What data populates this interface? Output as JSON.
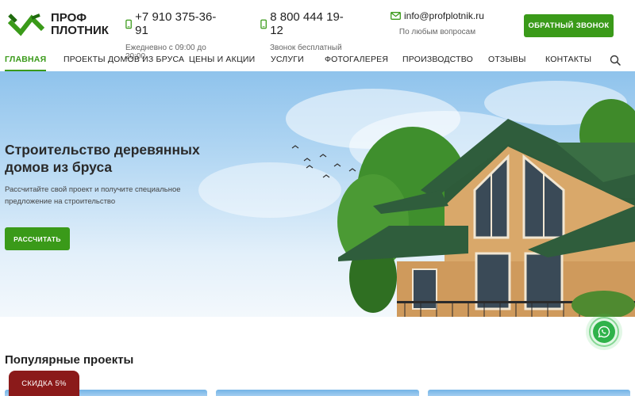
{
  "brand": {
    "name_line1": "ПРОФ",
    "name_line2": "ПЛОТНИК",
    "colors": {
      "accent": "#3a9a19",
      "discount": "#8b1a1a",
      "whatsapp": "#2fb24a"
    }
  },
  "header": {
    "phone1": {
      "number": "+7 910 375-36-91",
      "note": "Ежедневно с 09:00 до 20:00",
      "icon": "phone-icon"
    },
    "phone2": {
      "number": "8 800 444 19-12",
      "note": "Звонок бесплатный",
      "icon": "phone-icon"
    },
    "email": {
      "address": "info@profplotnik.ru",
      "note": "По любым вопросам",
      "icon": "mail-icon"
    },
    "callback_label": "ОБРАТНЫЙ ЗВОНОК"
  },
  "nav": {
    "items": [
      {
        "label": "ГЛАВНАЯ",
        "active": true
      },
      {
        "label": "ПРОЕКТЫ ДОМОВ ИЗ БРУСА"
      },
      {
        "label": "ЦЕНЫ И АКЦИИ"
      },
      {
        "label": "УСЛУГИ"
      },
      {
        "label": "ФОТОГАЛЕРЕЯ"
      },
      {
        "label": "ПРОИЗВОДСТВО"
      },
      {
        "label": "ОТЗЫВЫ"
      },
      {
        "label": "КОНТАКТЫ"
      }
    ],
    "search_icon": "search-icon"
  },
  "hero": {
    "title": "Строительство деревянных домов из бруса",
    "text": "Рассчитайте свой проект и получите специальное предложение на строительство",
    "button_label": "РАССЧИТАТЬ"
  },
  "popular": {
    "title": "Популярные проекты"
  },
  "discount_label": "СКИДКА 5%",
  "whatsapp_icon": "whatsapp-icon"
}
